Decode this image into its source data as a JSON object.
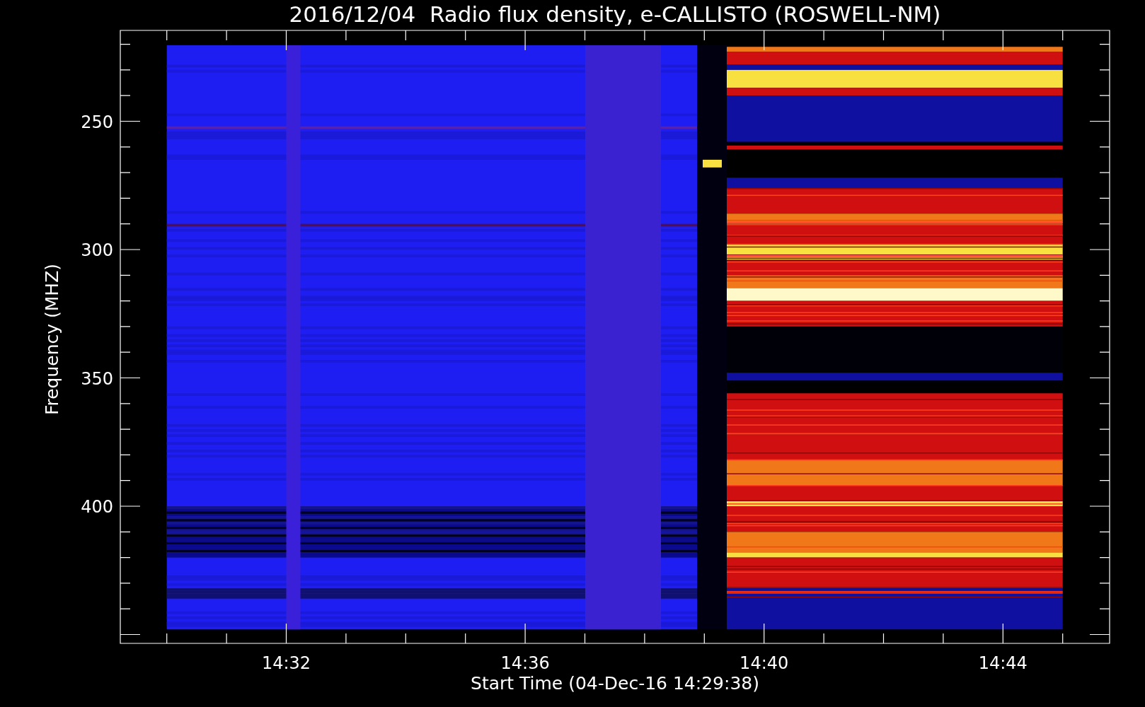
{
  "title": "2016/12/04  Radio flux density, e-CALLISTO (ROSWELL-NM)",
  "x_axis": {
    "label": "Start Time (04-Dec-16 14:29:38)",
    "tick_labels": [
      "14:32",
      "14:36",
      "14:40",
      "14:44"
    ]
  },
  "y_axis": {
    "label": "Frequency (MHZ)",
    "tick_labels": [
      "250",
      "300",
      "350",
      "400"
    ]
  }
}
